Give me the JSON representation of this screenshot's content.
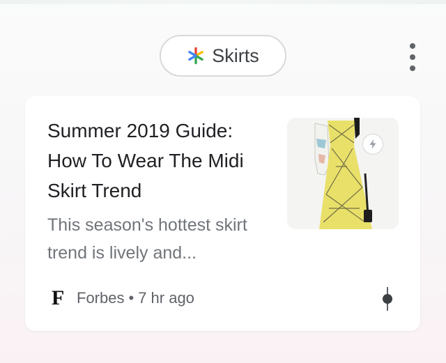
{
  "topic_chip": {
    "label": "Skirts",
    "icon": "multicolor-asterisk-icon",
    "icon_colors": [
      "#ea4335",
      "#fbbc04",
      "#34a853",
      "#4285f4"
    ]
  },
  "header": {
    "more_icon": "vertical-ellipsis-icon"
  },
  "card": {
    "headline": "Summer 2019 Guide: How To Wear The Midi Skirt Trend",
    "snippet": "This season's hottest skirt trend is lively and...",
    "thumbnail_icon": "amp-lightning-icon",
    "source": {
      "logo": "F",
      "name": "Forbes",
      "separator": "•",
      "time": "7 hr ago"
    },
    "more_icon": "more-options-icon"
  },
  "colors": {
    "card_background": "#ffffff",
    "headline_text": "#202124",
    "snippet_text": "#70757a",
    "meta_text": "#5f6368",
    "dress_yellow": "#e9e06a"
  }
}
